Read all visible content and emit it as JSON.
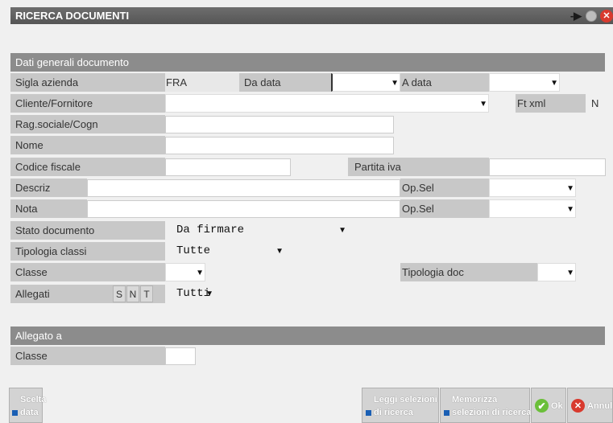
{
  "window": {
    "title": "RICERCA DOCUMENTI"
  },
  "section_general": {
    "title": "Dati generali documento"
  },
  "sigla_azienda": {
    "label": "Sigla azienda",
    "value": "FRA"
  },
  "da_data": {
    "label": "Da data",
    "value": ""
  },
  "a_data": {
    "label": "A data",
    "value": ""
  },
  "cliente_fornitore": {
    "label": "Cliente/Fornitore",
    "value": ""
  },
  "ft_xml": {
    "label": "Ft xml",
    "value": "N"
  },
  "rag_sociale": {
    "label": "Rag.sociale/Cogn",
    "value": ""
  },
  "nome": {
    "label": "Nome",
    "value": ""
  },
  "codice_fiscale": {
    "label": "Codice fiscale",
    "value": ""
  },
  "partita_iva": {
    "label": "Partita iva",
    "value": ""
  },
  "descriz": {
    "label": "Descriz",
    "value": "",
    "opsel_label": "Op.Sel",
    "opsel_value": ""
  },
  "nota": {
    "label": "Nota",
    "value": "",
    "opsel_label": "Op.Sel",
    "opsel_value": ""
  },
  "stato_documento": {
    "label": "Stato documento",
    "value": "Da firmare"
  },
  "tipologia_classi": {
    "label": "Tipologia classi",
    "value": "Tutte"
  },
  "classe": {
    "label": "Classe",
    "value": ""
  },
  "tipologia_doc": {
    "label": "Tipologia doc",
    "value": ""
  },
  "allegati": {
    "label": "Allegati",
    "s": "S",
    "n": "N",
    "t": "T",
    "value": "Tutti"
  },
  "section_allegato": {
    "title": "Allegato a"
  },
  "allegato_classe": {
    "label": "Classe",
    "value": ""
  },
  "buttons": {
    "scelta_data": "Scelta\ndata",
    "leggi": "Leggi selezioni\ndi ricerca",
    "memorizza": "Memorizza\nselezioni di ricerca",
    "ok": "Ok",
    "annulla": "Annull"
  },
  "colors": {
    "titlebar": "#5e5e5e",
    "section": "#8c8c8c",
    "label_bg": "#c8c8c8",
    "accent": "#1a5fb4"
  }
}
